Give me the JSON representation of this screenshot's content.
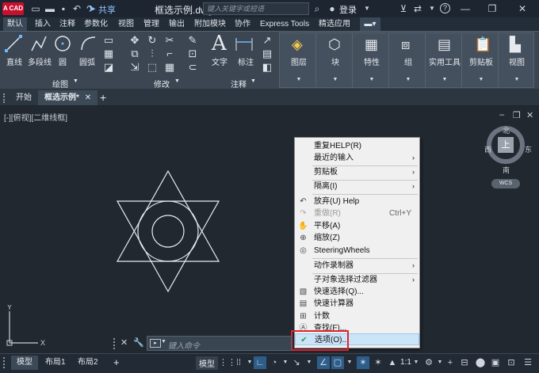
{
  "titlebar": {
    "logo_text": "A CAD",
    "share": "共享",
    "title": "框选示例.dwg",
    "search_placeholder": "键入关键字或短语",
    "login": "登录",
    "help": "?"
  },
  "ribbon_tabs": [
    "默认",
    "插入",
    "注释",
    "参数化",
    "视图",
    "管理",
    "输出",
    "附加模块",
    "协作",
    "Express Tools",
    "精选应用"
  ],
  "ribbon": {
    "draw_tools": [
      "直线",
      "多段线",
      "圆",
      "圆弧"
    ],
    "draw_group": "绘图",
    "modify_group": "修改",
    "annotation_tools": [
      "文字",
      "标注"
    ],
    "annotation_group": "注释",
    "big_buttons": [
      "图层",
      "块",
      "特性",
      "组",
      "实用工具",
      "剪贴板",
      "视图"
    ]
  },
  "file_tabs": {
    "start": "开始",
    "drawing": "框选示例*",
    "add": "+"
  },
  "viewport": {
    "view_label": "[-][俯视][二维线框]",
    "compass": {
      "north": "北",
      "south": "南",
      "east": "东",
      "west": "西",
      "top": "上",
      "wcs": "WCS"
    }
  },
  "context_menu": {
    "items": [
      {
        "label": "重复HELP(R)",
        "icon": "",
        "shortcut": "",
        "submenu": false
      },
      {
        "label": "最近的输入",
        "icon": "",
        "shortcut": "",
        "submenu": true
      },
      {
        "label": "剪贴板",
        "icon": "",
        "shortcut": "",
        "submenu": true
      },
      {
        "label": "隔离(I)",
        "icon": "",
        "shortcut": "",
        "submenu": true
      },
      {
        "label": "放弃(U) Help",
        "icon": "undo-icon",
        "shortcut": "",
        "submenu": false
      },
      {
        "label": "重做(R)",
        "icon": "redo-icon",
        "shortcut": "Ctrl+Y",
        "submenu": false
      },
      {
        "label": "平移(A)",
        "icon": "pan-icon",
        "shortcut": "",
        "submenu": false
      },
      {
        "label": "缩放(Z)",
        "icon": "zoom-icon",
        "shortcut": "",
        "submenu": false
      },
      {
        "label": "SteeringWheels",
        "icon": "steering-wheel-icon",
        "shortcut": "",
        "submenu": false
      },
      {
        "label": "动作录制器",
        "icon": "",
        "shortcut": "",
        "submenu": true
      },
      {
        "label": "子对象选择过滤器",
        "icon": "",
        "shortcut": "",
        "submenu": true
      },
      {
        "label": "快速选择(Q)...",
        "icon": "quick-select-icon",
        "shortcut": "",
        "submenu": false
      },
      {
        "label": "快速计算器",
        "icon": "calculator-icon",
        "shortcut": "",
        "submenu": false
      },
      {
        "label": "计数",
        "icon": "count-icon",
        "shortcut": "",
        "submenu": false
      },
      {
        "label": "查找(F)...",
        "icon": "find-icon",
        "shortcut": "",
        "submenu": false
      },
      {
        "label": "选项(O)...",
        "icon": "check-icon",
        "shortcut": "",
        "submenu": false
      }
    ]
  },
  "command_line": {
    "placeholder": "键入命令"
  },
  "statusbar": {
    "tabs": [
      "模型",
      "布局1",
      "布局2"
    ],
    "add": "+",
    "model_button": "模型",
    "scale": "1:1"
  },
  "colors": {
    "accent": "#0078d7",
    "highlight_outline": "#e0222d"
  }
}
